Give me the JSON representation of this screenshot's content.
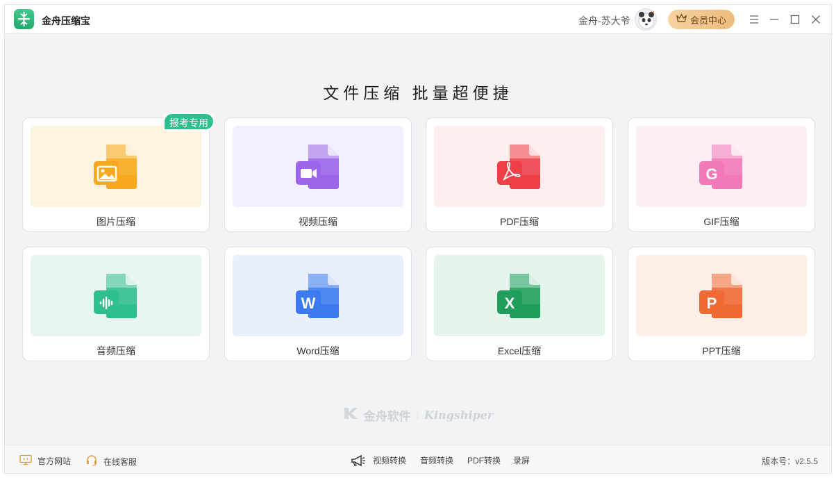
{
  "app": {
    "title": "金舟压缩宝"
  },
  "header": {
    "user_name": "金舟-苏大爷",
    "vip_label": "会员中心"
  },
  "main": {
    "headline": "文件压缩  批量超便捷",
    "cards": [
      {
        "label": "图片压缩",
        "tag": "报考专用",
        "bg": "#fdf3de",
        "color": "#f7a81c",
        "glyph": "image"
      },
      {
        "label": "视频压缩",
        "bg": "#f4effc",
        "color": "#9b64ea",
        "glyph": "video"
      },
      {
        "label": "PDF压缩",
        "bg": "#feeeee",
        "color": "#ee3f48",
        "glyph": "pdf"
      },
      {
        "label": "GIF压缩",
        "bg": "#fdeef6",
        "color": "#f279b8",
        "glyph": "G"
      },
      {
        "label": "音频压缩",
        "bg": "#e7f6f0",
        "color": "#2fbf8d",
        "glyph": "audio"
      },
      {
        "label": "Word压缩",
        "bg": "#e8f0fd",
        "color": "#3b7bef",
        "glyph": "W"
      },
      {
        "label": "Excel压缩",
        "bg": "#e5f5ec",
        "color": "#1f9e5c",
        "glyph": "X"
      },
      {
        "label": "PPT压缩",
        "bg": "#fdeee7",
        "color": "#f06a36",
        "glyph": "P"
      }
    ]
  },
  "watermark": {
    "cn": "金舟软件",
    "en": "Kingshiper"
  },
  "footer": {
    "official_site": "官方网站",
    "online_service": "在线客服",
    "tools": [
      "视频转换",
      "音频转换",
      "PDF转换",
      "录屏"
    ],
    "version": "版本号：v2.5.5"
  },
  "icons": {
    "app_logo": "compress-logo-icon",
    "window_controls": [
      "menu-icon",
      "minimize-icon",
      "maximize-icon",
      "close-icon"
    ]
  }
}
